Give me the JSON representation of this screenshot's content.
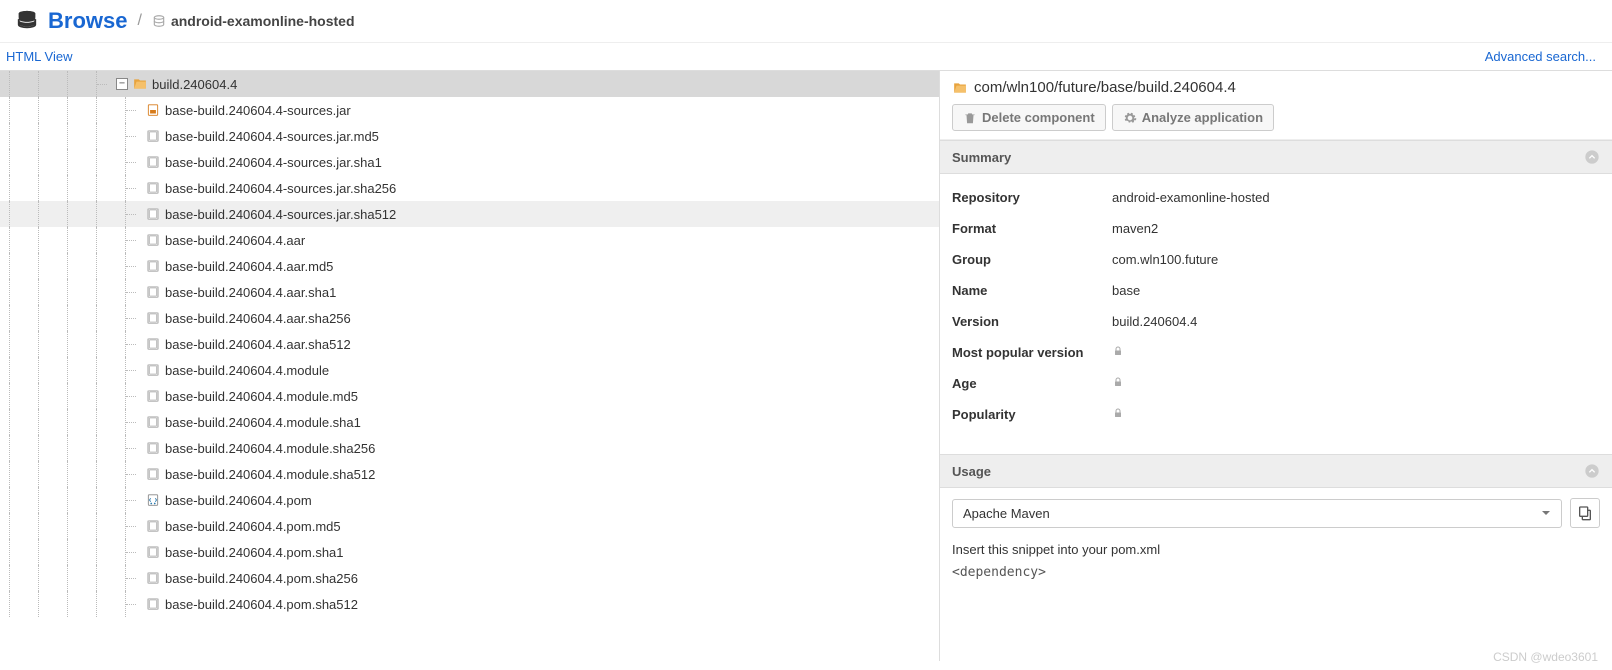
{
  "header": {
    "title": "Browse",
    "repo_name": "android-examonline-hosted"
  },
  "toolbar": {
    "html_view": "HTML View",
    "advanced_search": "Advanced search..."
  },
  "tree": {
    "folder_label": "build.240604.4",
    "files": [
      {
        "name": "base-build.240604.4-sources.jar",
        "type": "jar"
      },
      {
        "name": "base-build.240604.4-sources.jar.md5",
        "type": "file"
      },
      {
        "name": "base-build.240604.4-sources.jar.sha1",
        "type": "file"
      },
      {
        "name": "base-build.240604.4-sources.jar.sha256",
        "type": "file"
      },
      {
        "name": "base-build.240604.4-sources.jar.sha512",
        "type": "file",
        "hovered": true
      },
      {
        "name": "base-build.240604.4.aar",
        "type": "file"
      },
      {
        "name": "base-build.240604.4.aar.md5",
        "type": "file"
      },
      {
        "name": "base-build.240604.4.aar.sha1",
        "type": "file"
      },
      {
        "name": "base-build.240604.4.aar.sha256",
        "type": "file"
      },
      {
        "name": "base-build.240604.4.aar.sha512",
        "type": "file"
      },
      {
        "name": "base-build.240604.4.module",
        "type": "file"
      },
      {
        "name": "base-build.240604.4.module.md5",
        "type": "file"
      },
      {
        "name": "base-build.240604.4.module.sha1",
        "type": "file"
      },
      {
        "name": "base-build.240604.4.module.sha256",
        "type": "file"
      },
      {
        "name": "base-build.240604.4.module.sha512",
        "type": "file"
      },
      {
        "name": "base-build.240604.4.pom",
        "type": "pom"
      },
      {
        "name": "base-build.240604.4.pom.md5",
        "type": "file"
      },
      {
        "name": "base-build.240604.4.pom.sha1",
        "type": "file"
      },
      {
        "name": "base-build.240604.4.pom.sha256",
        "type": "file"
      },
      {
        "name": "base-build.240604.4.pom.sha512",
        "type": "file"
      }
    ]
  },
  "detail": {
    "path": "com/wln100/future/base/build.240604.4",
    "delete_label": "Delete component",
    "analyze_label": "Analyze application",
    "summary_title": "Summary",
    "usage_title": "Usage",
    "rows": [
      {
        "label": "Repository",
        "value": "android-examonline-hosted"
      },
      {
        "label": "Format",
        "value": "maven2"
      },
      {
        "label": "Group",
        "value": "com.wln100.future"
      },
      {
        "label": "Name",
        "value": "base"
      },
      {
        "label": "Version",
        "value": "build.240604.4"
      },
      {
        "label": "Most popular version",
        "locked": true
      },
      {
        "label": "Age",
        "locked": true
      },
      {
        "label": "Popularity",
        "locked": true
      }
    ],
    "usage_select": "Apache Maven",
    "usage_hint": "Insert this snippet into your pom.xml",
    "snippet": "<dependency>"
  },
  "watermark": "CSDN @wdeo3601"
}
